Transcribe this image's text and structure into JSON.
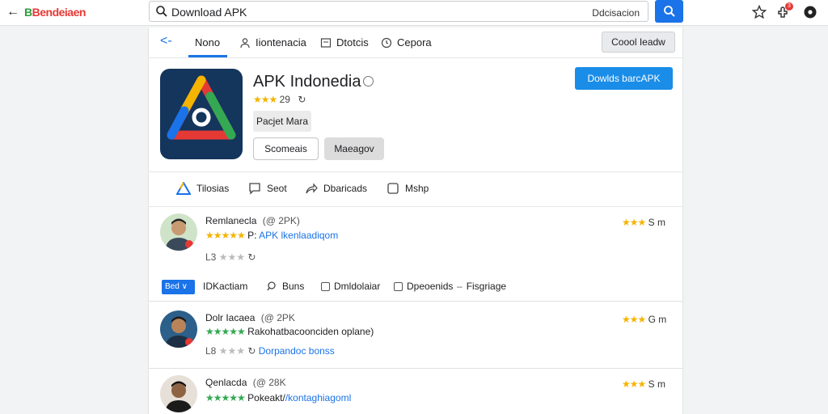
{
  "topbar": {
    "brand": "Bendeiaen",
    "search_value": "Download APK",
    "search_hint": "Ddcisacion",
    "notification_count": "3"
  },
  "nav": {
    "tabs": [
      {
        "label": "Nono",
        "active": true
      },
      {
        "label": "Iiontenacia"
      },
      {
        "label": "Dtotcis"
      },
      {
        "label": "Cepora"
      }
    ],
    "right_button": "Coool Ieadw"
  },
  "app": {
    "title": "APK Indonedia",
    "rating_stars": "★★★",
    "rating_value": "29",
    "category_chip": "Pacjet Mara",
    "button_outline": "Scomeais",
    "button_grey": "Maeagov",
    "download_button": "Dowlds barcAPK"
  },
  "actions": [
    {
      "label": "Tilosias",
      "icon": "logo-a-icon"
    },
    {
      "label": "Seot",
      "icon": "comment-icon"
    },
    {
      "label": "Dbaricads",
      "icon": "share-icon"
    },
    {
      "label": "Mshp",
      "icon": "checkbox-icon"
    }
  ],
  "filters": {
    "pill": "Bed",
    "items": [
      {
        "label": "IDKactiam",
        "icon": "none"
      },
      {
        "label": "Buns",
        "icon": "search-icon"
      },
      {
        "label": "Dmldolaiar",
        "icon": "checkbox-icon"
      },
      {
        "label": "Dpeoenids",
        "icon": "checkbox-icon"
      },
      {
        "label": "Fisgriage",
        "icon": "dash-icon"
      }
    ]
  },
  "reviews": [
    {
      "name": "Remlanecla",
      "tag": "(@ 2PK)",
      "stars": "★★★★★",
      "text_prefix": "P:",
      "text_link": "APK lkenlaadiqom",
      "meta": "L3",
      "meta_stars": "★★★",
      "right_stars": "★★★",
      "right_text": "S m"
    },
    {
      "name": "Dolr Iacaea",
      "tag": "(@ 2PK",
      "stars": "★★★★★",
      "text_prefix": "",
      "text_plain": "Rakohatbacoonciden oplane)",
      "meta": "L8",
      "meta_stars": "★★★",
      "meta_link": "Dorpandoc bonss",
      "right_stars": "★★★",
      "right_text": "G m"
    },
    {
      "name": "Qenlacda",
      "tag": "(@ 28K",
      "stars": "★★★★★",
      "text_prefix": "Pokeakt/",
      "text_link": "/kontaghiagoml",
      "right_stars": "★★★",
      "right_text": "S m"
    }
  ],
  "colors": {
    "accent": "#1a73e8",
    "download": "#1a8de8",
    "star_yellow": "#f4b400",
    "star_green": "#34a853"
  }
}
